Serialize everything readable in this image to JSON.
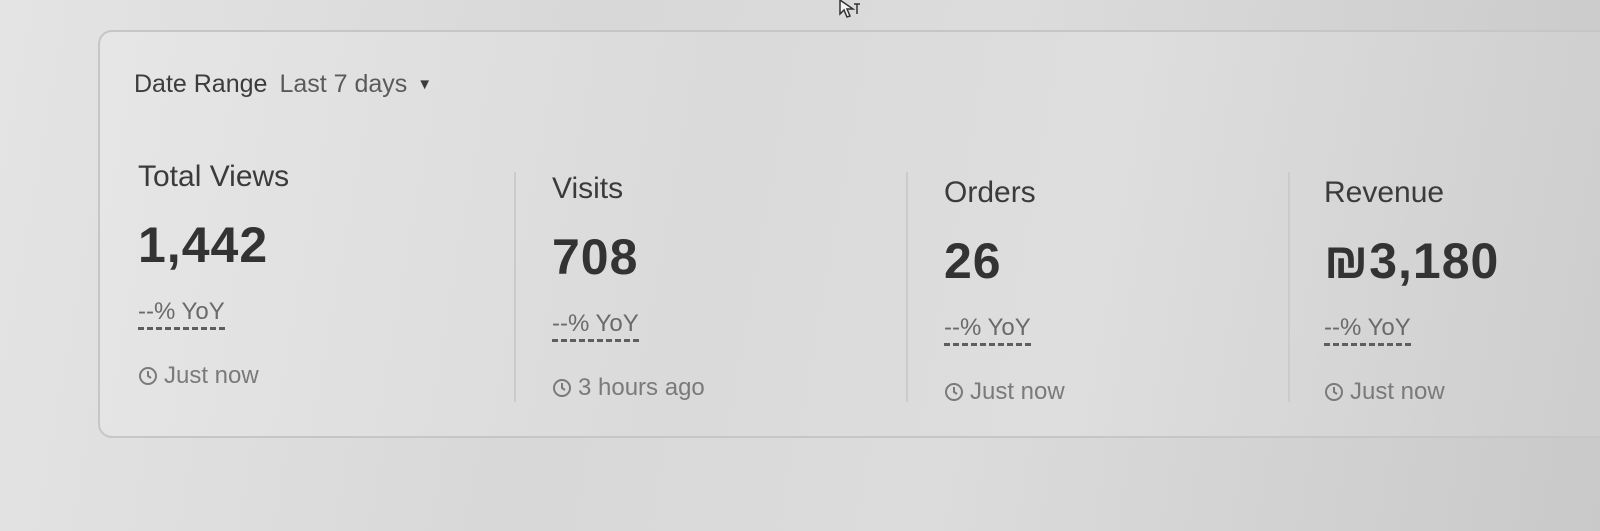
{
  "date_range": {
    "label": "Date Range",
    "value": "Last 7 days"
  },
  "metrics": [
    {
      "title": "Total Views",
      "value": "1,442",
      "yoy": "--% YoY",
      "updated": "Just now"
    },
    {
      "title": "Visits",
      "value": "708",
      "yoy": "--% YoY",
      "updated": "3 hours ago"
    },
    {
      "title": "Orders",
      "value": "26",
      "yoy": "--% YoY",
      "updated": "Just now"
    },
    {
      "title": "Revenue",
      "value": "₪3,180",
      "yoy": "--% YoY",
      "updated": "Just now"
    }
  ],
  "icons": {
    "caret": "caret-down-icon",
    "clock": "clock-icon",
    "cursor": "mouse-pointer-icon"
  }
}
